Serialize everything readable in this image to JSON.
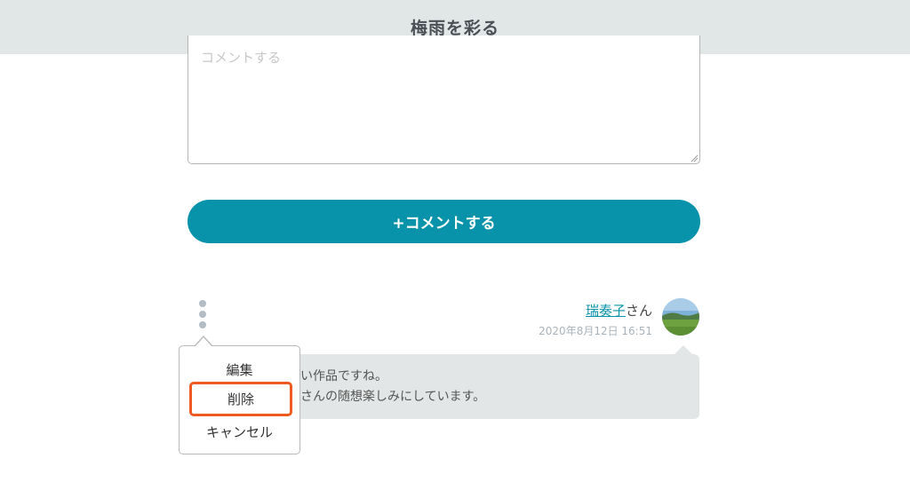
{
  "header": {
    "title": "梅雨を彩る"
  },
  "comment_form": {
    "placeholder": "コメントする",
    "submit_label": "+コメントする"
  },
  "comment": {
    "author": "瑞奏子",
    "author_suffix": "さん",
    "date": "2020年8月12日 16:51",
    "text_line1": "い作品ですね。",
    "text_line2": "さんの随想楽しみにしています。"
  },
  "menu": {
    "edit": "編集",
    "delete": "削除",
    "cancel": "キャンセル"
  },
  "colors": {
    "accent": "#0893aa",
    "highlight": "#ee5a22",
    "header_bg": "#e1e6e6"
  }
}
